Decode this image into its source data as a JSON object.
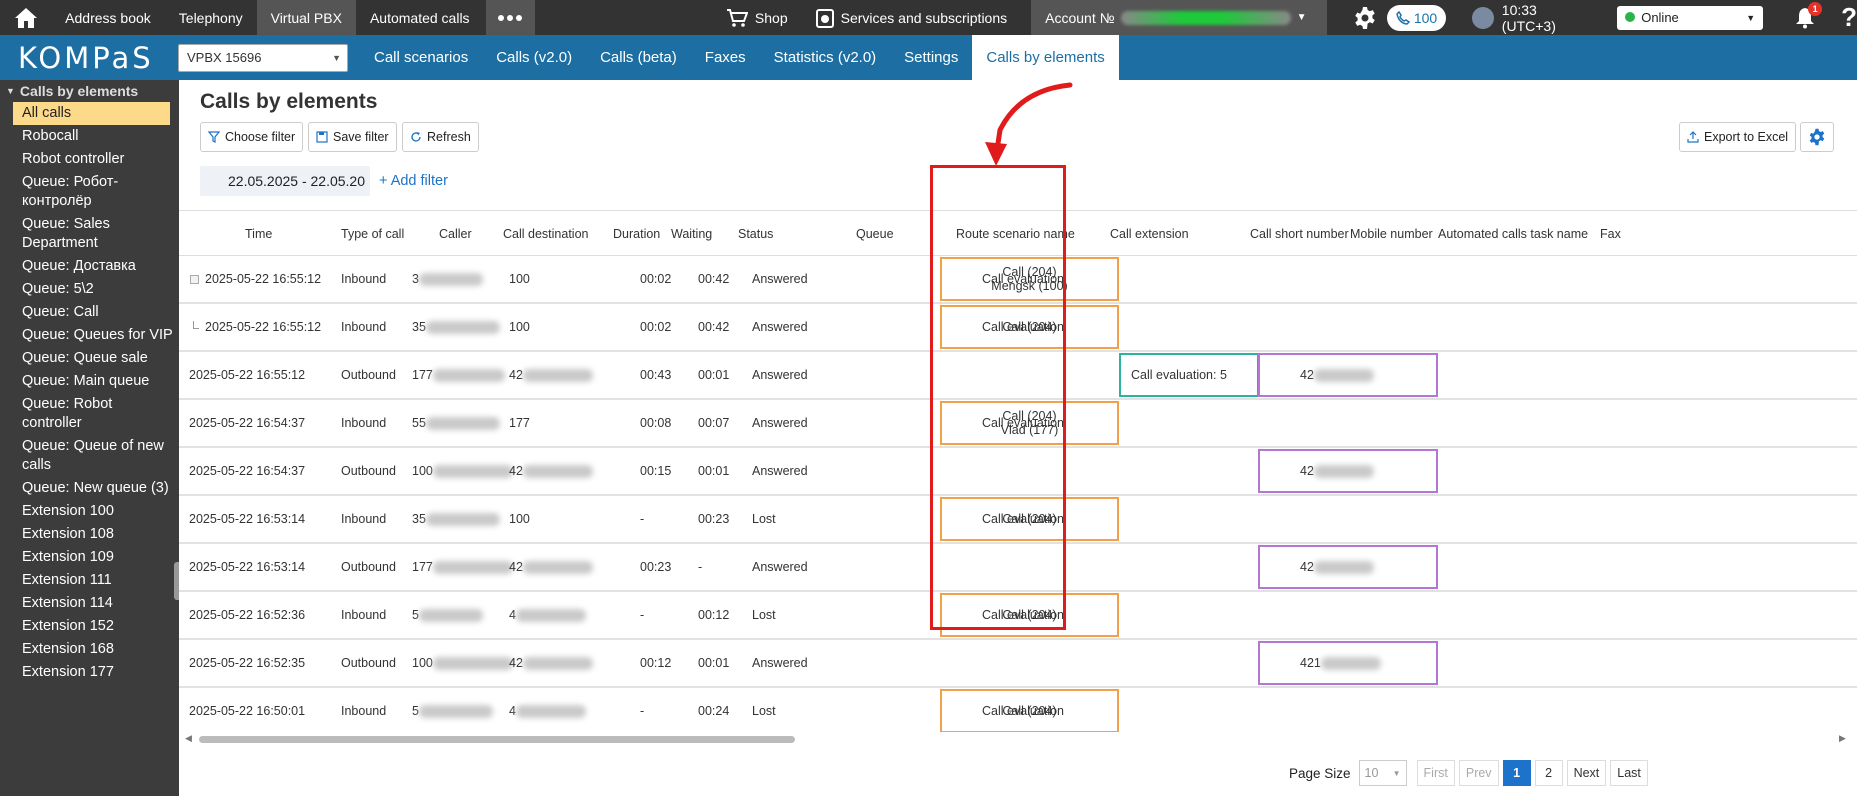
{
  "topbar": {
    "items": [
      "Address book",
      "Telephony",
      "Virtual PBX",
      "Automated calls"
    ],
    "shop": "Shop",
    "services": "Services and subscriptions",
    "account_label": "Account №",
    "phone_count": "100",
    "time": "10:33 (UTC+3)",
    "status": "Online",
    "bell_count": "1"
  },
  "navbar": {
    "logo": "KOMPaS",
    "pbx_select": "VPBX 15696",
    "tabs": [
      "Call scenarios",
      "Calls (v2.0)",
      "Calls (beta)",
      "Faxes",
      "Statistics (v2.0)",
      "Settings",
      "Calls by elements"
    ]
  },
  "sidebar": {
    "header": "Calls by elements",
    "items": [
      "All calls",
      "Robocall",
      "Robot controller",
      "Queue: Робот-контролёр",
      "Queue: Sales Department",
      "Queue: Доставка",
      "Queue: 5\\2",
      "Queue: Call",
      "Queue: Queues for VIP",
      "Queue: Queue sale",
      "Queue: Main queue",
      "Queue: Robot controller",
      "Queue: Queue of new calls",
      "Queue: New queue (3)",
      "Extension 100",
      "Extension 108",
      "Extension 109",
      "Extension 111",
      "Extension 114",
      "Extension 152",
      "Extension 168",
      "Extension 177"
    ]
  },
  "main": {
    "title": "Calls by elements",
    "buttons": {
      "choose_filter": "Choose filter",
      "save_filter": "Save filter",
      "refresh": "Refresh",
      "export": "Export to Excel"
    },
    "date_range": "22.05.2025 - 22.05.20",
    "add_filter": "+ Add filter"
  },
  "table": {
    "columns": [
      "Time",
      "Type of call",
      "Caller",
      "Call destination",
      "Duration",
      "Waiting",
      "Status",
      "Queue",
      "Route scenario name",
      "Call extension",
      "Call short number",
      "Mobile number",
      "Automated calls task name",
      "Fax"
    ],
    "rows": [
      {
        "time": "2025-05-22 16:55:12",
        "type": "Inbound",
        "caller": "3",
        "dest": "100",
        "duration": "00:02",
        "waiting": "00:42",
        "status": "Answered",
        "queue": [
          "Call (204)",
          "Mengsk (100)"
        ],
        "route": "Call evaluation",
        "ext": ""
      },
      {
        "time": "2025-05-22 16:55:12",
        "type": "Inbound",
        "caller": "35",
        "dest": "100",
        "duration": "00:02",
        "waiting": "00:42",
        "status": "Answered",
        "queue": [
          "Call (204)"
        ],
        "route": "Call evaluation",
        "ext": ""
      },
      {
        "time": "2025-05-22 16:55:12",
        "type": "Outbound",
        "caller": "177",
        "dest": "42",
        "duration": "00:43",
        "waiting": "00:01",
        "status": "Answered",
        "queue": [],
        "route": "Call evaluation: 5",
        "ext": "42"
      },
      {
        "time": "2025-05-22 16:54:37",
        "type": "Inbound",
        "caller": "55",
        "dest": "177",
        "duration": "00:08",
        "waiting": "00:07",
        "status": "Answered",
        "queue": [
          "Call (204)",
          "Vlad (177)"
        ],
        "route": "Call evaluation",
        "ext": ""
      },
      {
        "time": "2025-05-22 16:54:37",
        "type": "Outbound",
        "caller": "100",
        "dest": "42",
        "duration": "00:15",
        "waiting": "00:01",
        "status": "Answered",
        "queue": [],
        "route": "",
        "ext": "42"
      },
      {
        "time": "2025-05-22 16:53:14",
        "type": "Inbound",
        "caller": "35",
        "dest": "100",
        "duration": "-",
        "waiting": "00:23",
        "status": "Lost",
        "queue": [
          "Call (204)"
        ],
        "route": "Call evaluation",
        "ext": ""
      },
      {
        "time": "2025-05-22 16:53:14",
        "type": "Outbound",
        "caller": "177",
        "dest": "42",
        "duration": "00:23",
        "waiting": "-",
        "status": "Answered",
        "queue": [],
        "route": "",
        "ext": "42"
      },
      {
        "time": "2025-05-22 16:52:36",
        "type": "Inbound",
        "caller": "5",
        "dest": "4",
        "duration": "-",
        "waiting": "00:12",
        "status": "Lost",
        "queue": [
          "Call (204)"
        ],
        "route": "Call evaluation",
        "ext": ""
      },
      {
        "time": "2025-05-22 16:52:35",
        "type": "Outbound",
        "caller": "100",
        "dest": "42",
        "duration": "00:12",
        "waiting": "00:01",
        "status": "Answered",
        "queue": [],
        "route": "",
        "ext": "421"
      },
      {
        "time": "2025-05-22 16:50:01",
        "type": "Inbound",
        "caller": "5",
        "dest": "4",
        "duration": "-",
        "waiting": "00:24",
        "status": "Lost",
        "queue": [
          "Call (204)"
        ],
        "route": "Call evaluation",
        "ext": ""
      }
    ]
  },
  "pager": {
    "page_size_label": "Page Size",
    "page_size": "10",
    "first": "First",
    "prev": "Prev",
    "pages": [
      "1",
      "2"
    ],
    "next": "Next",
    "last": "Last"
  },
  "colors": {
    "nav": "#1d6fa3",
    "topbar": "#333333",
    "queue_border": "#f0a24a",
    "ext_border": "#b377d2",
    "eval_border": "#2bb3a0",
    "highlight": "#e11b1b"
  }
}
